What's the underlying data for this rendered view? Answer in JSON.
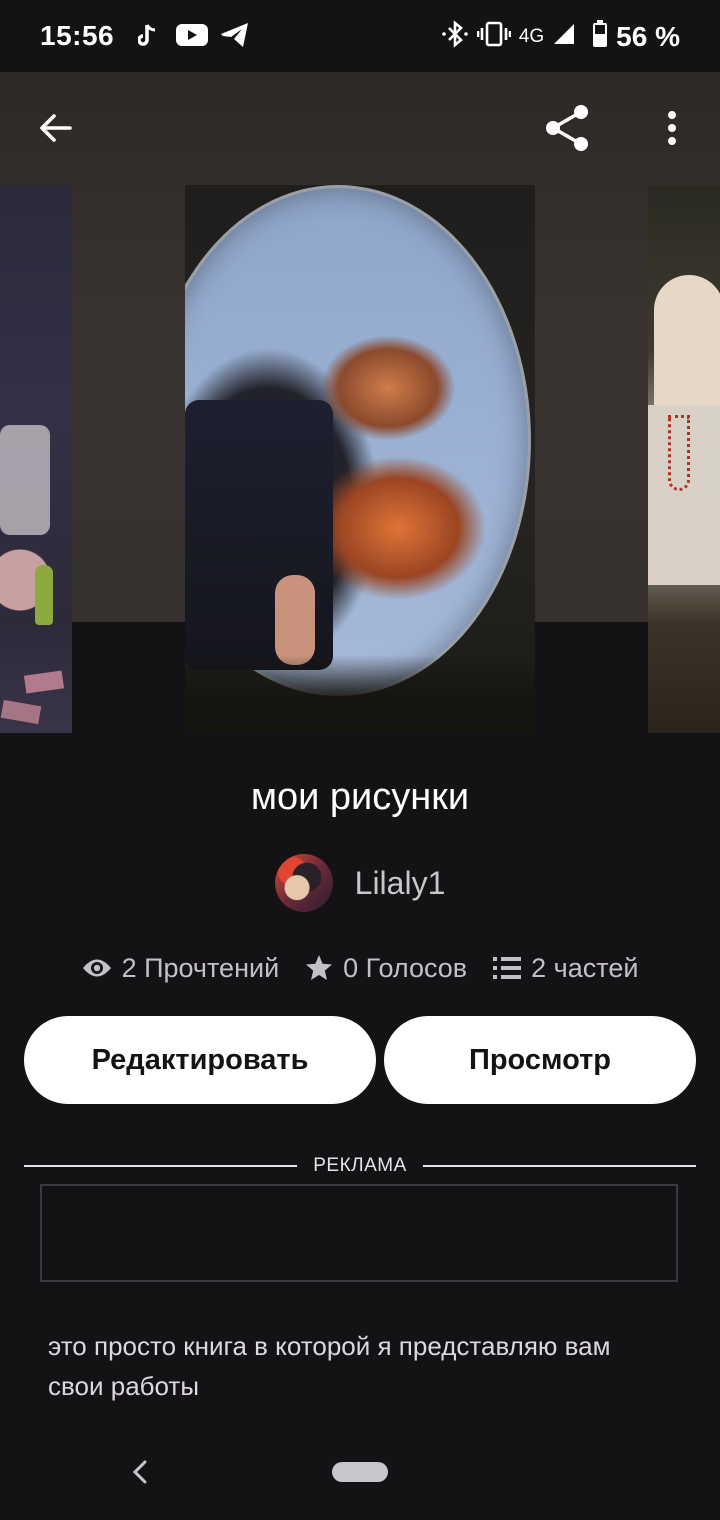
{
  "status_bar": {
    "time": "15:56",
    "network": "4G",
    "battery_percent": "56 %",
    "icons": [
      "tiktok-icon",
      "youtube-icon",
      "telegram-icon",
      "bluetooth-icon",
      "vibrate-icon",
      "signal-icon",
      "battery-icon"
    ]
  },
  "app_bar": {
    "icons": [
      "back-arrow-icon",
      "share-icon",
      "more-vert-icon"
    ]
  },
  "book": {
    "title": "мои рисунки",
    "author": "Lilaly1",
    "reads": "2 Прочтений",
    "votes": "0 Голосов",
    "parts": "2 частей",
    "description": "это просто  книга в которой я представляю вам свои работы"
  },
  "actions": {
    "edit_label": "Редактировать",
    "view_label": "Просмотр"
  },
  "ad": {
    "label": "РЕКЛАМА"
  },
  "colors": {
    "background": "#141215",
    "button_bg": "#ffffff",
    "button_text": "#141215",
    "muted_text": "#c4c1c6"
  }
}
